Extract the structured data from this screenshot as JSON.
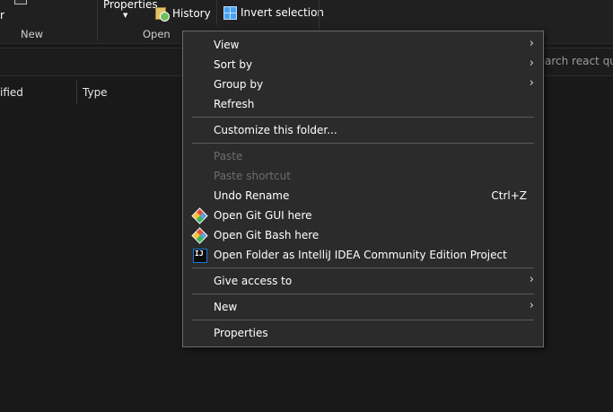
{
  "ribbon": {
    "partial_label": "r",
    "properties_label": "Properties",
    "history_label": "History",
    "invert_selection_label": "Invert selection",
    "group_new": "New",
    "group_open": "Open"
  },
  "address": {
    "search_placeholder": "Search react questio"
  },
  "columns": {
    "modified_partial": "ified",
    "type": "Type"
  },
  "context_menu": {
    "view": "View",
    "sort_by": "Sort by",
    "group_by": "Group by",
    "refresh": "Refresh",
    "customize": "Customize this folder...",
    "paste": "Paste",
    "paste_shortcut": "Paste shortcut",
    "undo_rename": "Undo Rename",
    "undo_shortcut": "Ctrl+Z",
    "git_gui": "Open Git GUI here",
    "git_bash": "Open Git Bash here",
    "intellij": "Open Folder as IntelliJ IDEA Community Edition Project",
    "intellij_icon_text": "IJ",
    "give_access": "Give access to",
    "new": "New",
    "properties": "Properties",
    "submenu_arrow": "›"
  },
  "colors": {
    "menu_bg": "#2b2b2b",
    "menu_border": "#6a6a6a",
    "disabled_text": "#6d6d6d",
    "app_bg": "#191919"
  }
}
